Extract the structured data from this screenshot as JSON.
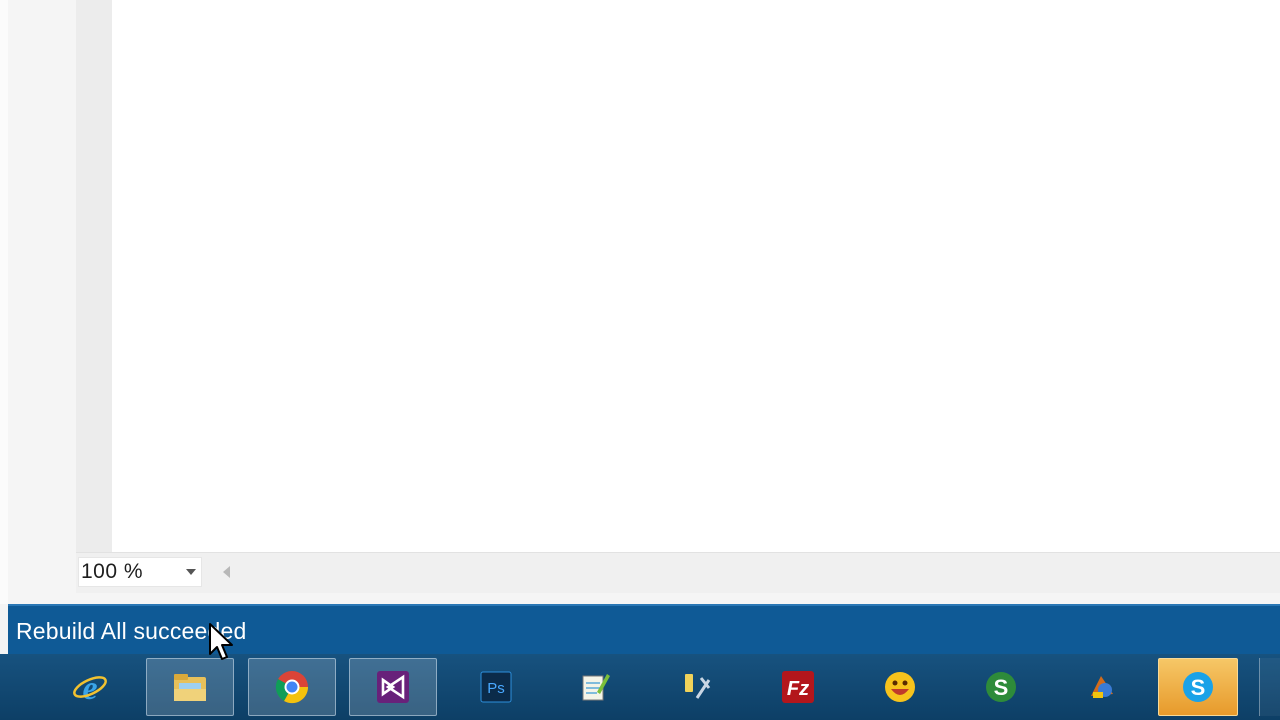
{
  "zoom": {
    "value": "100 %"
  },
  "status": {
    "text": "Rebuild All succeeded"
  },
  "taskbar": {
    "apps": [
      {
        "name": "internet-explorer-icon",
        "active": false
      },
      {
        "name": "file-explorer-icon",
        "active": true
      },
      {
        "name": "chrome-icon",
        "active": true
      },
      {
        "name": "visual-studio-icon",
        "active": true
      },
      {
        "name": "photoshop-icon",
        "active": false,
        "label": "Ps"
      },
      {
        "name": "notepad-icon",
        "active": false
      },
      {
        "name": "tools-icon",
        "active": false
      },
      {
        "name": "filezilla-icon",
        "active": false,
        "label": "Fz"
      },
      {
        "name": "yahoo-messenger-icon",
        "active": false
      },
      {
        "name": "s-app-icon",
        "active": false,
        "label": "S"
      },
      {
        "name": "app-icon",
        "active": false
      },
      {
        "name": "skype-icon",
        "active": false,
        "highlighted": true,
        "label": "S"
      }
    ]
  },
  "colors": {
    "status_bar": "#0f5a96",
    "taskbar": "#0d3f66",
    "skype_highlight": "#e79a2b"
  }
}
